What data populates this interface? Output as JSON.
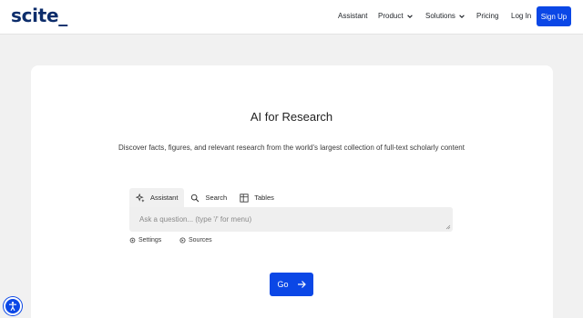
{
  "brand": {
    "logo": "scite_",
    "accent": "#0b47e6",
    "logo_color": "#0d2d6b"
  },
  "nav": {
    "assistant": "Assistant",
    "product": "Product",
    "solutions": "Solutions",
    "pricing": "Pricing",
    "login": "Log In",
    "signup": "Sign Up"
  },
  "hero": {
    "title": "AI for Research",
    "subtitle": "Discover facts, figures, and relevant research from the world's largest collection of full-text scholarly content"
  },
  "tabs": [
    {
      "label": "Assistant",
      "icon": "sparkle-icon",
      "active": true
    },
    {
      "label": "Search",
      "icon": "search-icon",
      "active": false
    },
    {
      "label": "Tables",
      "icon": "table-icon",
      "active": false
    }
  ],
  "query": {
    "placeholder": "Ask a question... (type '/' for menu)"
  },
  "options": {
    "settings": "Settings",
    "sources": "Sources"
  },
  "go": {
    "label": "Go"
  }
}
